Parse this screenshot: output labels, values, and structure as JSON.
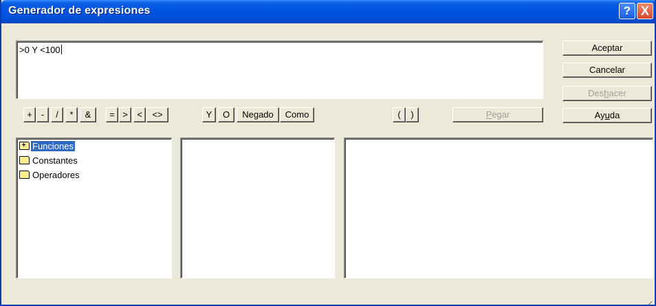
{
  "window": {
    "title": "Generador de expresiones"
  },
  "titlebar_buttons": {
    "help": "?",
    "close": "X"
  },
  "expression": {
    "value": ">0 Y <100"
  },
  "dialog_buttons": {
    "accept": "Aceptar",
    "cancel": "Cancelar",
    "undo_pre": "Des",
    "undo_u": "h",
    "undo_post": "acer",
    "help_pre": "Ay",
    "help_u": "u",
    "help_post": "da"
  },
  "operators": {
    "plus": "+",
    "minus": "-",
    "divide": "/",
    "multiply": "*",
    "ampersand": "&",
    "equal": "=",
    "greater": ">",
    "less": "<",
    "not_equal": "<>",
    "and": "Y",
    "or": "O",
    "not": "Negado",
    "like": "Como",
    "open_paren": "(",
    "close_paren": ")"
  },
  "paste": {
    "pre": "",
    "u": "P",
    "post": "egar"
  },
  "tree": {
    "items": [
      {
        "label": "Funciones",
        "expandable": true,
        "selected": true
      },
      {
        "label": "Constantes",
        "expandable": false,
        "selected": false
      },
      {
        "label": "Operadores",
        "expandable": false,
        "selected": false
      }
    ]
  },
  "colors": {
    "title_bar": "#0054e3",
    "selection": "#316ac5",
    "face": "#ece9d8"
  }
}
